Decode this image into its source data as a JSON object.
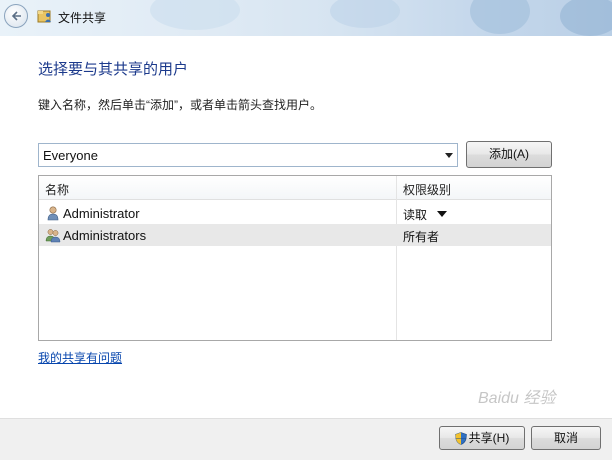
{
  "window": {
    "title": "文件共享",
    "back_icon": "back-arrow-icon",
    "app_icon": "file-share-icon"
  },
  "main": {
    "heading": "选择要与其共享的用户",
    "instruction": "键入名称，然后单击“添加”，或者单击箭头查找用户。",
    "combo_value": "Everyone",
    "add_button_label": "添加(A)"
  },
  "table": {
    "columns": [
      "名称",
      "权限级别"
    ],
    "rows": [
      {
        "name": "Administrator",
        "permission": "读取",
        "icon": "user-icon",
        "has_dropdown": true,
        "selected": false
      },
      {
        "name": "Administrators",
        "permission": "所有者",
        "icon": "user-group-icon",
        "has_dropdown": false,
        "selected": true
      }
    ]
  },
  "help_link": "我的共享有问题",
  "footer": {
    "share_button_label": "共享(H)",
    "share_icon": "uac-shield-icon",
    "cancel_button_label": "取消"
  },
  "watermark": "Baidu 经验",
  "colors": {
    "heading": "#1c3a8c",
    "link": "#0645ad",
    "footer_bg": "#f0f0f0"
  }
}
